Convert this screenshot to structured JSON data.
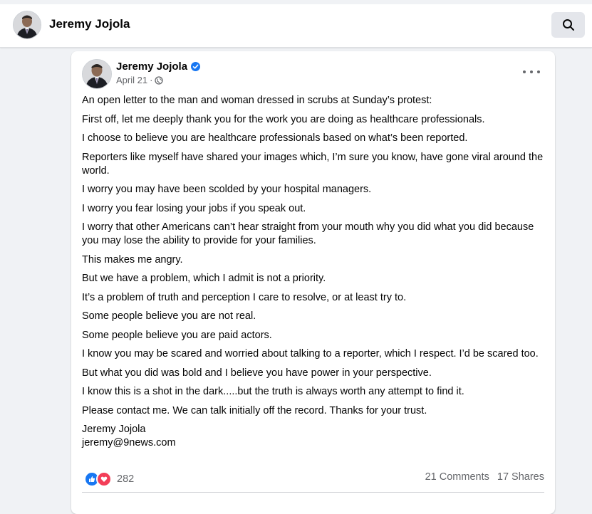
{
  "header": {
    "profile_name": "Jeremy Jojola",
    "search_icon": "search-icon"
  },
  "post": {
    "author": "Jeremy Jojola",
    "verified": true,
    "date": "April 21",
    "separator": "·",
    "privacy_icon": "globe-icon",
    "paragraphs": [
      "An open letter to the man and woman dressed in scrubs at Sunday’s protest:",
      "First off, let me deeply thank you for the work you are doing as healthcare professionals.",
      "I choose to believe you are healthcare professionals based on what’s been reported.",
      "Reporters like myself have shared your images which, I’m sure you know, have gone viral around the world.",
      "I worry you may have been scolded by your hospital managers.",
      "I worry you fear losing your jobs if you speak out.",
      "I worry that other Americans can’t hear straight from your mouth why you did what you did because you may lose the ability to provide for your families.",
      "This makes me angry.",
      "But we have a problem, which I admit is not a priority.",
      "It’s a problem of truth and perception I care to resolve, or at least try to.",
      "Some people believe you are not real.",
      "Some people believe you are paid actors.",
      "I know you may be scared and worried about talking to a reporter, which I respect. I’d be scared too.",
      "But what you did was bold and I believe you have power in your perspective.",
      "I know this is a shot in the dark.....but the truth is always worth any attempt to find it.",
      "Please contact me. We can talk initially off the record. Thanks for your trust."
    ],
    "signature_name": "Jeremy Jojola",
    "signature_email": "jeremy@9news.com",
    "reaction_count": "282",
    "comments": "21 Comments",
    "shares": "17 Shares"
  },
  "colors": {
    "brand_blue": "#1877f2",
    "love_red": "#f33e58",
    "secondary_text": "#65676b"
  }
}
